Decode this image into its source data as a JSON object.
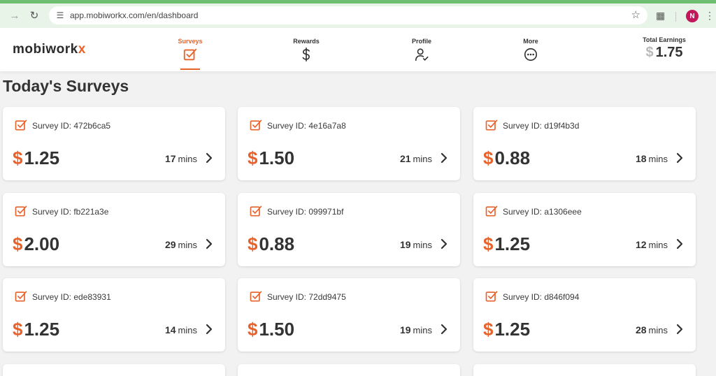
{
  "browser": {
    "url": "app.mobiworkx.com/en/dashboard",
    "avatar_letter": "N"
  },
  "header": {
    "logo_main": "mobiwork",
    "logo_accent": "x",
    "nav": [
      {
        "label": "Surveys",
        "icon": "checkbox-icon",
        "active": true
      },
      {
        "label": "Rewards",
        "icon": "dollar-icon",
        "active": false
      },
      {
        "label": "Profile",
        "icon": "user-check-icon",
        "active": false
      },
      {
        "label": "More",
        "icon": "more-dots-icon",
        "active": false
      }
    ],
    "earnings_label": "Total Earnings",
    "earnings_currency": "$",
    "earnings_value": "1.75"
  },
  "main": {
    "title": "Today's Surveys",
    "surveys": [
      {
        "id_text": "Survey ID: 472b6ca5",
        "currency": "$",
        "amount": "1.25",
        "minutes": "17",
        "unit": "mins"
      },
      {
        "id_text": "Survey ID: 4e16a7a8",
        "currency": "$",
        "amount": "1.50",
        "minutes": "21",
        "unit": "mins"
      },
      {
        "id_text": "Survey ID: d19f4b3d",
        "currency": "$",
        "amount": "0.88",
        "minutes": "18",
        "unit": "mins"
      },
      {
        "id_text": "Survey ID: fb221a3e",
        "currency": "$",
        "amount": "2.00",
        "minutes": "29",
        "unit": "mins"
      },
      {
        "id_text": "Survey ID: 099971bf",
        "currency": "$",
        "amount": "0.88",
        "minutes": "19",
        "unit": "mins"
      },
      {
        "id_text": "Survey ID: a1306eee",
        "currency": "$",
        "amount": "1.25",
        "minutes": "12",
        "unit": "mins"
      },
      {
        "id_text": "Survey ID: ede83931",
        "currency": "$",
        "amount": "1.25",
        "minutes": "14",
        "unit": "mins"
      },
      {
        "id_text": "Survey ID: 72dd9475",
        "currency": "$",
        "amount": "1.50",
        "minutes": "19",
        "unit": "mins"
      },
      {
        "id_text": "Survey ID: d846f094",
        "currency": "$",
        "amount": "1.25",
        "minutes": "28",
        "unit": "mins"
      }
    ]
  },
  "colors": {
    "accent": "#e8622c",
    "chrome_green": "#6fbf73"
  }
}
